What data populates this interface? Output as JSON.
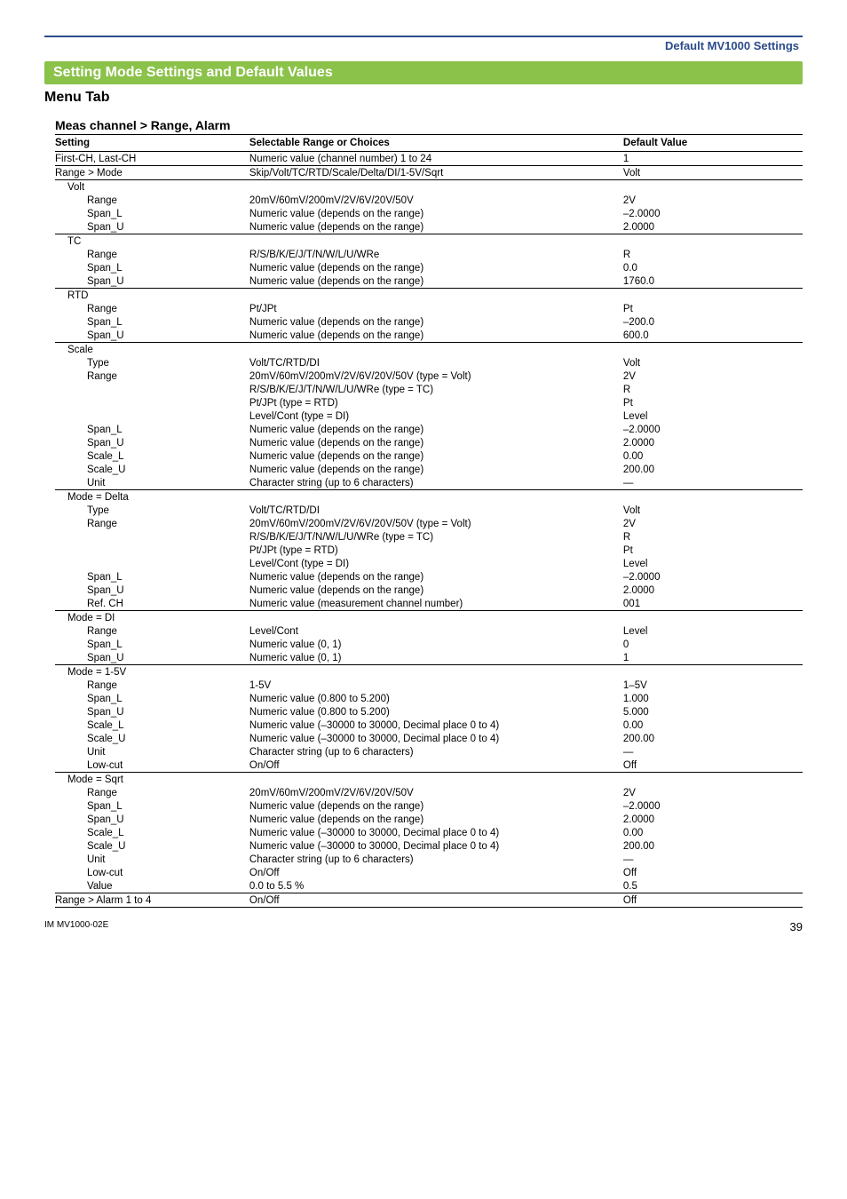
{
  "header": {
    "section_title": "Default MV1000 Settings"
  },
  "band": {
    "title": "Setting Mode Settings and Default Values"
  },
  "menu_tab": "Menu Tab",
  "table_title": "Meas channel > Range, Alarm",
  "cols": {
    "setting": "Setting",
    "choices": "Selectable Range or Choices",
    "default": "Default Value"
  },
  "rows": [
    {
      "s": "First-CH, Last-CH",
      "c": "Numeric value (channel number) 1 to 24",
      "d": "1",
      "rule": true
    },
    {
      "s": "Range > Mode",
      "c": "Skip/Volt/TC/RTD/Scale/Delta/DI/1-5V/Sqrt",
      "d": "Volt",
      "rule": true
    },
    {
      "s": "Volt",
      "c": "",
      "d": "",
      "rule": true,
      "indent": 1
    },
    {
      "s": "Range",
      "c": "20mV/60mV/200mV/2V/6V/20V/50V",
      "d": "2V",
      "indent": 2
    },
    {
      "s": "Span_L",
      "c": "Numeric value (depends on the range)",
      "d": "–2.0000",
      "indent": 2
    },
    {
      "s": "Span_U",
      "c": "Numeric value (depends on the range)",
      "d": "2.0000",
      "indent": 2
    },
    {
      "s": "TC",
      "c": "",
      "d": "",
      "rule": true,
      "indent": 1
    },
    {
      "s": "Range",
      "c": "R/S/B/K/E/J/T/N/W/L/U/WRe",
      "d": "R",
      "indent": 2
    },
    {
      "s": "Span_L",
      "c": "Numeric value (depends on the range)",
      "d": "0.0",
      "indent": 2
    },
    {
      "s": "Span_U",
      "c": "Numeric value (depends on the range)",
      "d": "1760.0",
      "indent": 2
    },
    {
      "s": "RTD",
      "c": "",
      "d": "",
      "rule": true,
      "indent": 1
    },
    {
      "s": "Range",
      "c": "Pt/JPt",
      "d": "Pt",
      "indent": 2
    },
    {
      "s": "Span_L",
      "c": "Numeric value (depends on the range)",
      "d": "–200.0",
      "indent": 2
    },
    {
      "s": "Span_U",
      "c": "Numeric value (depends on the range)",
      "d": "600.0",
      "indent": 2
    },
    {
      "s": "Scale",
      "c": "",
      "d": "",
      "rule": true,
      "indent": 1
    },
    {
      "s": "Type",
      "c": "Volt/TC/RTD/DI",
      "d": "Volt",
      "indent": 2
    },
    {
      "s": "Range",
      "c": "20mV/60mV/200mV/2V/6V/20V/50V (type = Volt)",
      "d": "2V",
      "indent": 2
    },
    {
      "s": "",
      "c": "R/S/B/K/E/J/T/N/W/L/U/WRe (type = TC)",
      "d": "R",
      "indent": 2
    },
    {
      "s": "",
      "c": "Pt/JPt (type = RTD)",
      "d": "Pt",
      "indent": 2
    },
    {
      "s": "",
      "c": "Level/Cont (type = DI)",
      "d": "Level",
      "indent": 2
    },
    {
      "s": "Span_L",
      "c": "Numeric value (depends on the range)",
      "d": "–2.0000",
      "indent": 2
    },
    {
      "s": "Span_U",
      "c": "Numeric value (depends on the range)",
      "d": "2.0000",
      "indent": 2
    },
    {
      "s": "Scale_L",
      "c": "Numeric value (depends on the range)",
      "d": "0.00",
      "indent": 2
    },
    {
      "s": "Scale_U",
      "c": "Numeric value (depends on the range)",
      "d": "200.00",
      "indent": 2
    },
    {
      "s": "Unit",
      "c": "Character string (up to 6 characters)",
      "d": "—",
      "indent": 2
    },
    {
      "s": "Mode = Delta",
      "c": "",
      "d": "",
      "rule": true,
      "indent": 1
    },
    {
      "s": "Type",
      "c": "Volt/TC/RTD/DI",
      "d": "Volt",
      "indent": 2
    },
    {
      "s": "Range",
      "c": "20mV/60mV/200mV/2V/6V/20V/50V (type = Volt)",
      "d": "2V",
      "indent": 2
    },
    {
      "s": "",
      "c": "R/S/B/K/E/J/T/N/W/L/U/WRe (type = TC)",
      "d": "R",
      "indent": 2
    },
    {
      "s": "",
      "c": "Pt/JPt (type = RTD)",
      "d": "Pt",
      "indent": 2
    },
    {
      "s": "",
      "c": "Level/Cont (type = DI)",
      "d": "Level",
      "indent": 2
    },
    {
      "s": "Span_L",
      "c": "Numeric value (depends on the range)",
      "d": "–2.0000",
      "indent": 2
    },
    {
      "s": "Span_U",
      "c": "Numeric value (depends on the range)",
      "d": "2.0000",
      "indent": 2
    },
    {
      "s": "Ref. CH",
      "c": "Numeric value (measurement channel number)",
      "d": "001",
      "indent": 2
    },
    {
      "s": "Mode = DI",
      "c": "",
      "d": "",
      "rule": true,
      "indent": 1
    },
    {
      "s": "Range",
      "c": "Level/Cont",
      "d": "Level",
      "indent": 2
    },
    {
      "s": "Span_L",
      "c": "Numeric value (0, 1)",
      "d": "0",
      "indent": 2
    },
    {
      "s": "Span_U",
      "c": "Numeric value (0, 1)",
      "d": "1",
      "indent": 2
    },
    {
      "s": "Mode = 1-5V",
      "c": "",
      "d": "",
      "rule": true,
      "indent": 1
    },
    {
      "s": "Range",
      "c": "1-5V",
      "d": "1–5V",
      "indent": 2
    },
    {
      "s": "Span_L",
      "c": "Numeric value (0.800 to 5.200)",
      "d": "1.000",
      "indent": 2
    },
    {
      "s": "Span_U",
      "c": "Numeric value (0.800 to 5.200)",
      "d": "5.000",
      "indent": 2
    },
    {
      "s": "Scale_L",
      "c": "Numeric value (–30000 to 30000, Decimal place 0 to 4)",
      "d": "0.00",
      "indent": 2
    },
    {
      "s": "Scale_U",
      "c": "Numeric value (–30000 to 30000, Decimal place 0 to 4)",
      "d": "200.00",
      "indent": 2
    },
    {
      "s": "Unit",
      "c": "Character string (up to 6 characters)",
      "d": "—",
      "indent": 2
    },
    {
      "s": "Low-cut",
      "c": "On/Off",
      "d": "Off",
      "indent": 2
    },
    {
      "s": "Mode = Sqrt",
      "c": "",
      "d": "",
      "rule": true,
      "indent": 1
    },
    {
      "s": "Range",
      "c": "20mV/60mV/200mV/2V/6V/20V/50V",
      "d": "2V",
      "indent": 2
    },
    {
      "s": "Span_L",
      "c": "Numeric value (depends on the range)",
      "d": "–2.0000",
      "indent": 2
    },
    {
      "s": "Span_U",
      "c": "Numeric value (depends on the range)",
      "d": "2.0000",
      "indent": 2
    },
    {
      "s": "Scale_L",
      "c": "Numeric value (–30000 to 30000, Decimal place 0 to 4)",
      "d": "0.00",
      "indent": 2
    },
    {
      "s": "Scale_U",
      "c": "Numeric value (–30000 to 30000, Decimal place 0 to 4)",
      "d": "200.00",
      "indent": 2
    },
    {
      "s": "Unit",
      "c": "Character string (up to 6 characters)",
      "d": "—",
      "indent": 2
    },
    {
      "s": "Low-cut",
      "c": "On/Off",
      "d": "Off",
      "indent": 2
    },
    {
      "s": "Value",
      "c": "0.0 to 5.5 %",
      "d": "0.5",
      "indent": 2
    },
    {
      "s": "Range > Alarm 1 to 4",
      "c": "On/Off",
      "d": "Off",
      "rule": true,
      "end": true
    }
  ],
  "footer": {
    "doc_id": "IM MV1000-02E",
    "page": "39"
  }
}
